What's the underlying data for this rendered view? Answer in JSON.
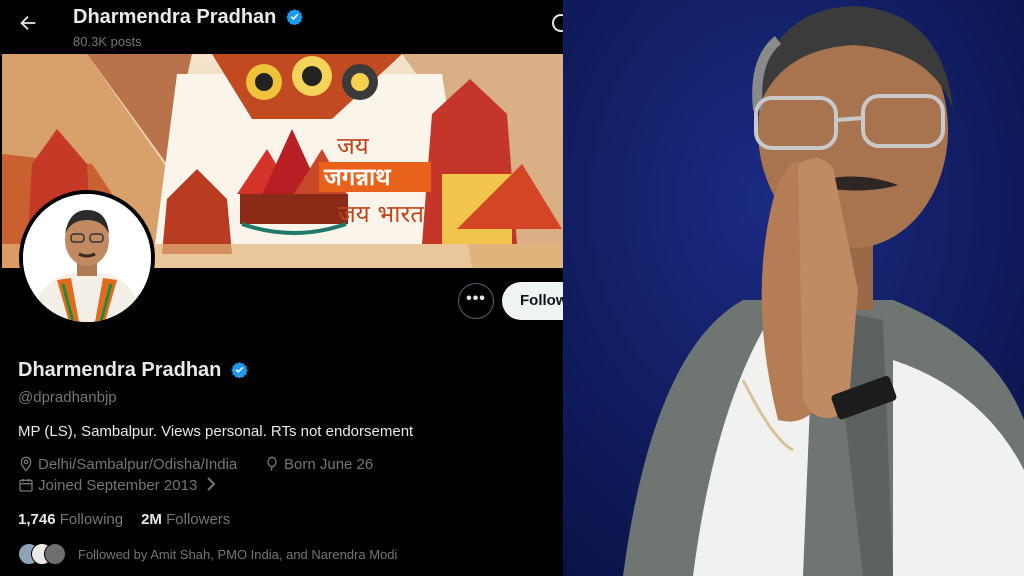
{
  "header": {
    "name": "Dharmendra Pradhan",
    "posts": "80.3K posts"
  },
  "banner": {
    "line1": "जय",
    "line2": "जगन्नाथ",
    "line3": "जय भारत"
  },
  "buttons": {
    "more": "•••",
    "follow": "Follow"
  },
  "profile": {
    "name": "Dharmendra Pradhan",
    "handle": "@dpradhanbjp",
    "bio": "MP (LS), Sambalpur. Views personal. RTs not endorsement",
    "location": "Delhi/Sambalpur/Odisha/India",
    "born": "Born June 26",
    "joined": "Joined September 2013"
  },
  "stats": {
    "following_count": "1,746",
    "following_label": "Following",
    "followers_count": "2M",
    "followers_label": "Followers"
  },
  "followed_by": "Followed by Amit Shah, PMO India, and Narendra Modi",
  "colors": {
    "background": "#000000",
    "text": "#e7e9ea",
    "muted": "#71767b",
    "verified": "#1d9bf0",
    "banner_orange": "#e8621c"
  }
}
